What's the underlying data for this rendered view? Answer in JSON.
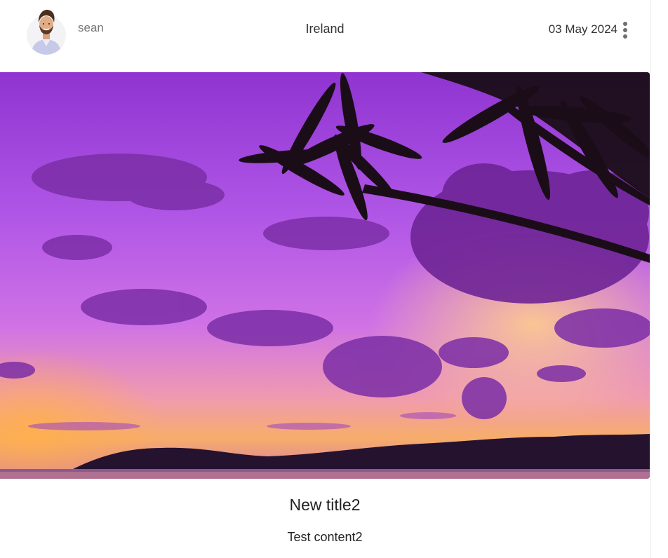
{
  "post": {
    "author": {
      "username": "sean",
      "avatar_icon": "avatar-photo"
    },
    "location": "Ireland",
    "date": "03 May 2024",
    "menu_icon": "more-vertical-icon",
    "image": {
      "subject": "palm-trees-purple-sunset-photo"
    },
    "title": "New title2",
    "content": "Test content2"
  },
  "colors": {
    "sky_top": "#9b3fd6",
    "sky_mid": "#c26ae8",
    "sky_horizon": "#f7a35c",
    "cloud": "#7a2fa3",
    "silhouette": "#1c1020",
    "menu_dots": "#6e6e6e",
    "username": "#767676"
  }
}
